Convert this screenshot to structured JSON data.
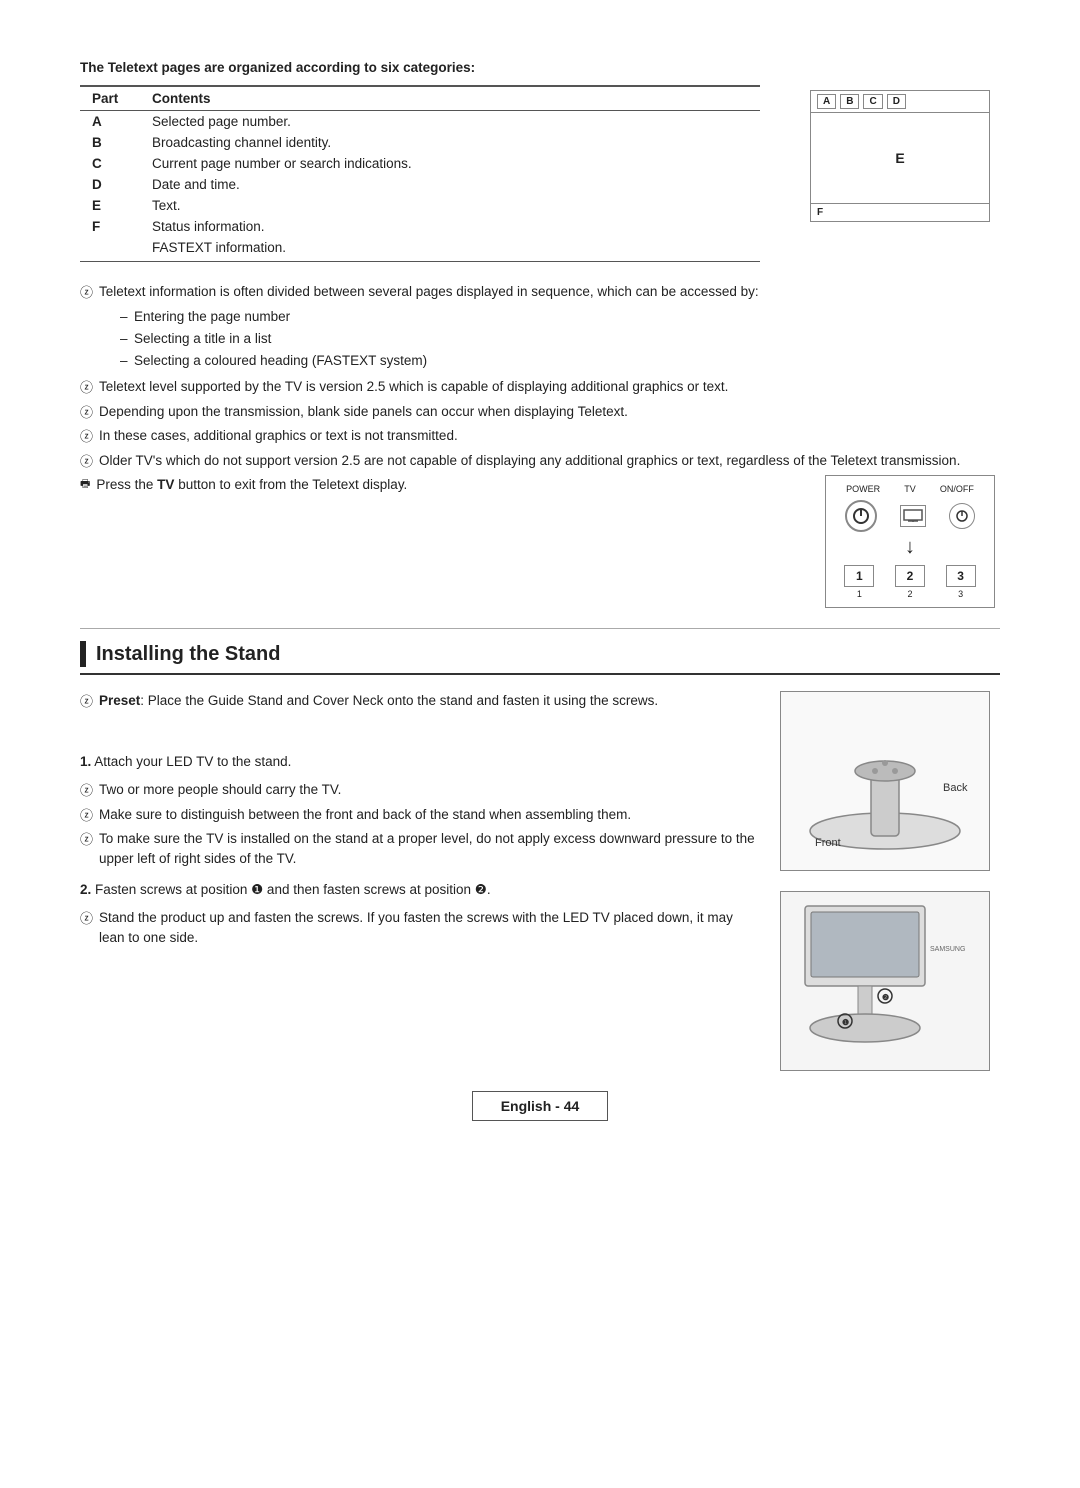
{
  "page": {
    "title": "Installing the Stand",
    "footer": "English - 44"
  },
  "teletext_section": {
    "intro": "The Teletext pages are organized according to six categories:",
    "table": {
      "headers": [
        "Part",
        "Contents"
      ],
      "rows": [
        {
          "part": "A",
          "contents": "Selected page number."
        },
        {
          "part": "B",
          "contents": "Broadcasting channel identity."
        },
        {
          "part": "C",
          "contents": "Current page number or search indications."
        },
        {
          "part": "D",
          "contents": "Date and time."
        },
        {
          "part": "E",
          "contents": "Text."
        },
        {
          "part": "F",
          "contents": "Status information."
        },
        {
          "part": "",
          "contents": "FASTEXT information."
        }
      ]
    },
    "tv_diagram": {
      "top_labels": [
        "A",
        "B",
        "C",
        "D"
      ],
      "center_label": "E",
      "bottom_label": "F"
    },
    "notes": [
      "Teletext information is often divided between several pages displayed in sequence, which can be accessed by:",
      "Teletext level supported by the TV is version 2.5 which is capable of displaying additional graphics or text.",
      "Depending upon the transmission, blank side panels can occur when displaying Teletext.",
      "In these cases, additional graphics or text is not transmitted.",
      "Older TV's which do not support version 2.5 are not capable of displaying any additional graphics or text, regardless of the Teletext transmission.",
      "Press the TV button to exit from the Teletext display."
    ],
    "bullet_points": [
      "Entering the page number",
      "Selecting a title in a list",
      "Selecting a coloured heading (FASTEXT system)"
    ]
  },
  "remote_diagram": {
    "labels_top": [
      "POWER",
      "TV",
      "ON/OFF"
    ],
    "buttons_row2": [
      "1",
      "2",
      "3"
    ]
  },
  "installing_stand": {
    "title": "Installing the Stand",
    "preset_note": "Preset: Place the Guide Stand and Cover Neck onto the stand and fasten it using the screws.",
    "back_label": "Back",
    "front_label": "Front",
    "steps": [
      {
        "number": "1.",
        "text": "Attach your LED TV to the stand."
      }
    ],
    "step1_notes": [
      "Two or more people should carry the TV.",
      "Make sure to distinguish between the front and back of the stand when assembling them.",
      "To make sure the TV is installed on the stand at a proper level, do not apply excess downward pressure to the upper left of right sides of the TV."
    ],
    "step2": {
      "text": "Fasten screws at position ❶ and then fasten screws at position ❷.",
      "note": "Stand the product up and fasten the screws. If you fasten the screws with the LED TV placed down, it may lean to one side."
    }
  }
}
